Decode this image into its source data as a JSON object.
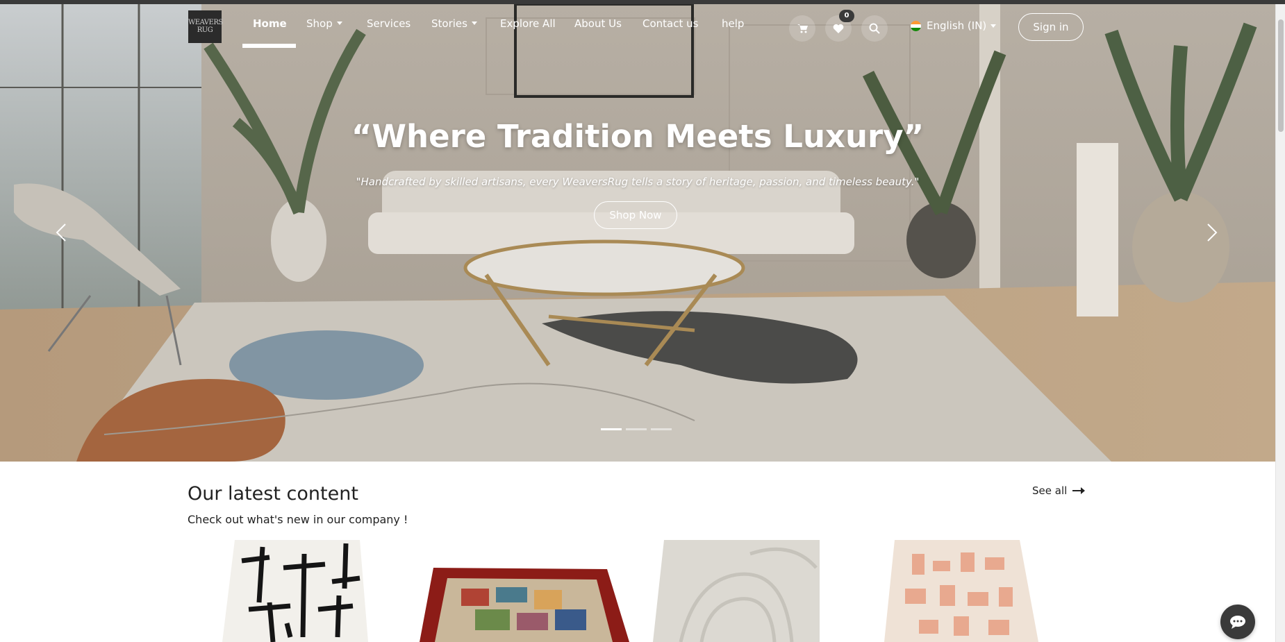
{
  "brand": {
    "logo_text_line1": "WEAVERS",
    "logo_text_line2": "RUG"
  },
  "nav": {
    "items": [
      {
        "label": "Home",
        "active": true
      },
      {
        "label": "Shop",
        "dropdown": true
      },
      {
        "label": "Services"
      },
      {
        "label": "Stories",
        "dropdown": true
      },
      {
        "label": "Explore All"
      },
      {
        "label": "About Us"
      },
      {
        "label": "Contact us"
      },
      {
        "label": "help"
      }
    ],
    "wishlist_count": "0",
    "language": "English (IN)",
    "sign_in": "Sign in"
  },
  "hero": {
    "title": "“Where Tradition Meets Luxury”",
    "subtitle": "\"Handcrafted by skilled artisans, every WeaversRug tells a story of heritage, passion, and timeless beauty.\"",
    "cta": "Shop Now",
    "slides_total": 3,
    "active_slide": 1
  },
  "content": {
    "title": "Our latest content",
    "subtitle": "Check out what's new in our company !",
    "see_all": "See all"
  },
  "icons": {
    "cart": "cart-icon",
    "wishlist": "heart-icon",
    "search": "search-icon",
    "prev": "chevron-left-icon",
    "next": "chevron-right-icon",
    "arrow": "arrow-right-icon",
    "chat": "chat-icon"
  },
  "colors": {
    "accent": "#3a3a3a",
    "text": "#222222"
  }
}
